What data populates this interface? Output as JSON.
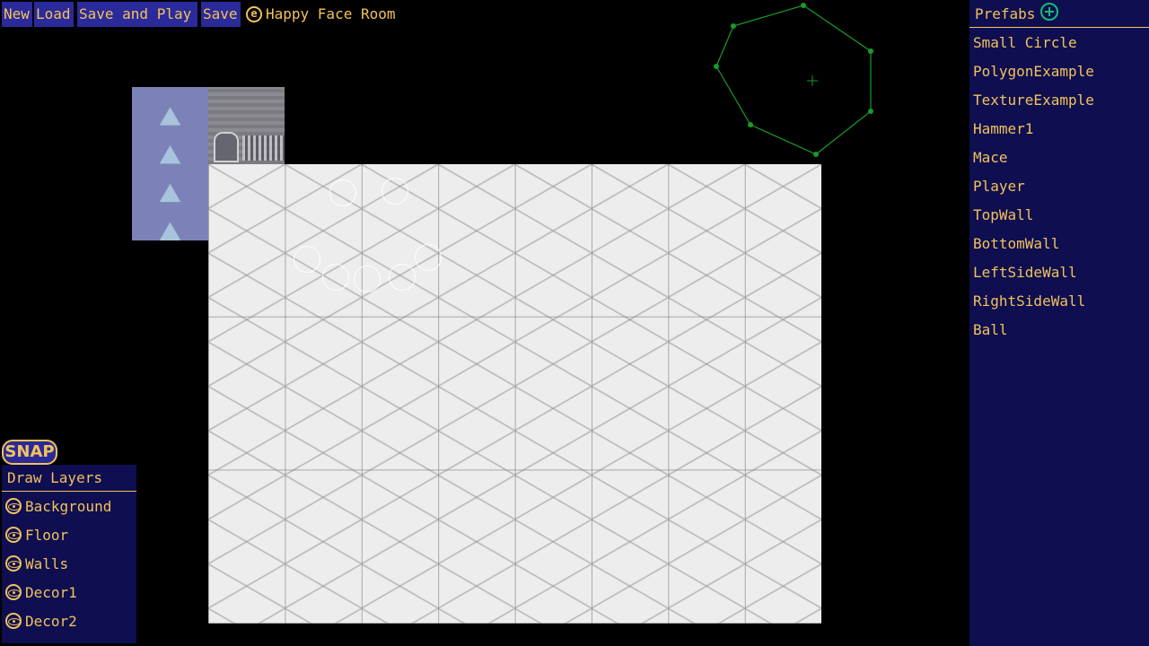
{
  "toolbar": {
    "new_label": "New",
    "load_label": "Load",
    "save_play_label": "Save and Play",
    "save_label": "Save",
    "room_icon": "e",
    "room_name": "Happy Face Room"
  },
  "snap": {
    "label": "SNAP"
  },
  "layers": {
    "title": "Draw Layers",
    "items": [
      {
        "label": "Background",
        "icon": "eye-icon"
      },
      {
        "label": "Floor",
        "icon": "eye-icon"
      },
      {
        "label": "Walls",
        "icon": "eye-icon"
      },
      {
        "label": "Decor1",
        "icon": "eye-icon"
      },
      {
        "label": "Decor2",
        "icon": "eye-icon"
      }
    ]
  },
  "prefabs": {
    "title": "Prefabs",
    "add_icon": "plus-circle-icon",
    "items": [
      "Small Circle",
      "PolygonExample",
      "TextureExample",
      "Hammer1",
      "Mace",
      "Player",
      "TopWall",
      "BottomWall",
      "LeftSideWall",
      "RightSideWall",
      "Ball"
    ]
  },
  "colors": {
    "background": "#000000",
    "panel": "#0e0e50",
    "button": "#2a2a9a",
    "text": "#f2c25c",
    "polygon": "#1a9a2a",
    "add": "#10c070"
  }
}
